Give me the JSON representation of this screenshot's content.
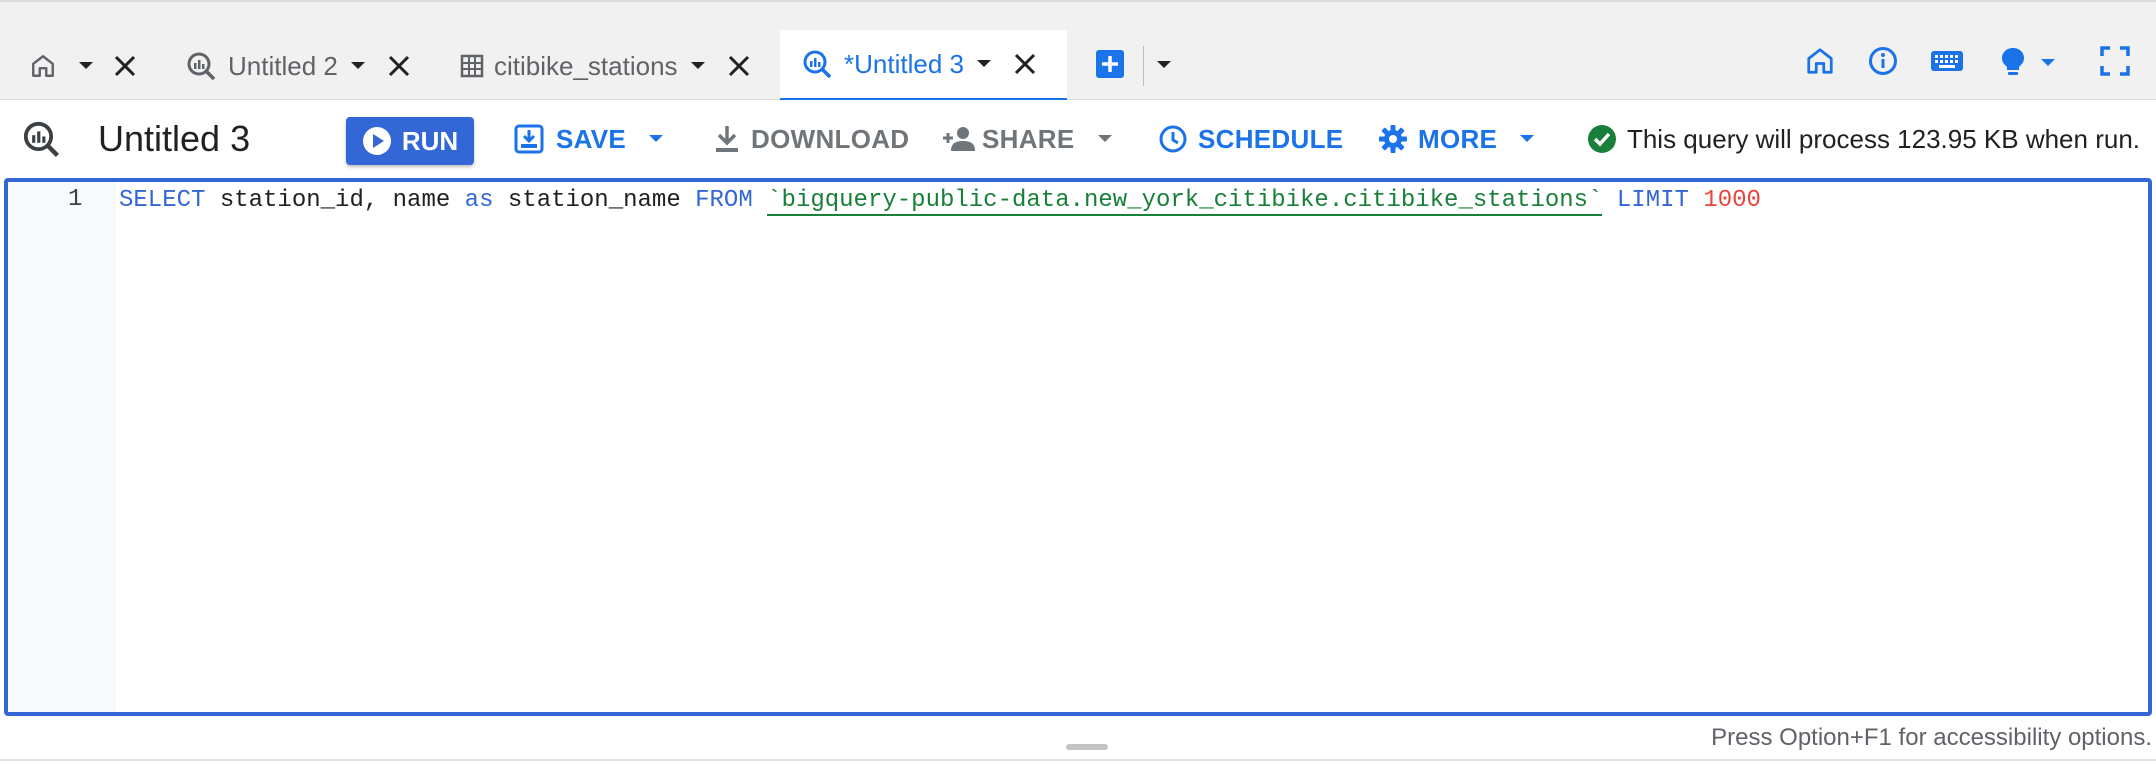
{
  "colors": {
    "accent": "#1a73e8",
    "run_bg": "#3367d6",
    "success": "#188038",
    "number": "#e8453c"
  },
  "tabs": [
    {
      "icon": "home-icon",
      "label": ""
    },
    {
      "icon": "query-icon",
      "label": "Untitled 2"
    },
    {
      "icon": "table-icon",
      "label": "citibike_stations"
    },
    {
      "icon": "query-icon",
      "label": "*Untitled 3",
      "active": true
    }
  ],
  "header_icons": [
    "add-tab-icon",
    "home-icon",
    "info-icon",
    "keyboard-icon",
    "lightbulb-icon",
    "fullscreen-icon"
  ],
  "toolbar": {
    "title": "Untitled 3",
    "run_label": "RUN",
    "save_label": "SAVE",
    "download_label": "DOWNLOAD",
    "share_label": "SHARE",
    "schedule_label": "SCHEDULE",
    "more_label": "MORE",
    "status_text": "This query will process 123.95 KB when run."
  },
  "editor": {
    "line_number": "1",
    "tokens": {
      "select": "SELECT",
      "cols": " station_id, name ",
      "as": "as",
      "alias": " station_name ",
      "from": "FROM",
      "space": " ",
      "table": "`bigquery-public-data.new_york_citibike.citibike_stations`",
      "limit": " LIMIT ",
      "limit_value": "1000"
    }
  },
  "footer": {
    "hint": "Press Option+F1 for accessibility options."
  }
}
